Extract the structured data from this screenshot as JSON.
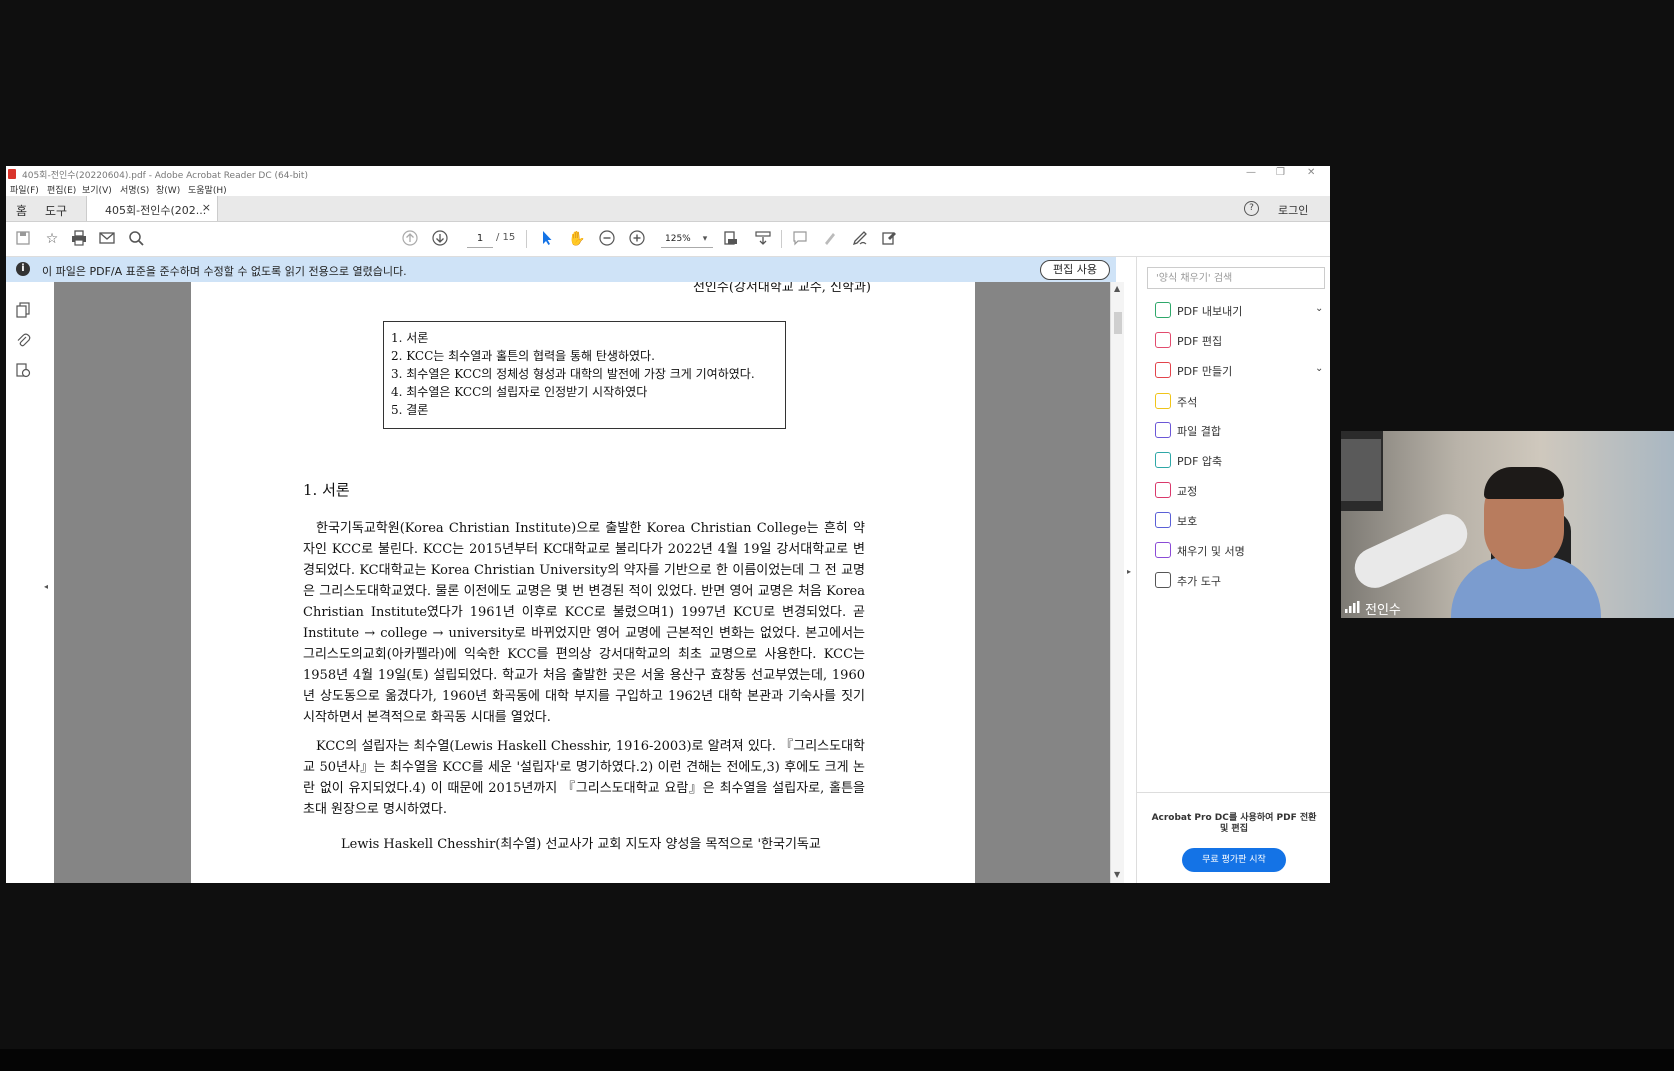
{
  "window": {
    "title": "405회-전인수(20220604).pdf - Adobe Acrobat Reader DC (64-bit)",
    "controls": {
      "minimize": "—",
      "restore": "❐",
      "close": "✕"
    }
  },
  "menu": [
    "파일(F)",
    "편집(E)",
    "보기(V)",
    "서명(S)",
    "창(W)",
    "도움말(H)"
  ],
  "tabs": {
    "home": "홈",
    "tools": "도구",
    "document": "405회-전인수(202...",
    "close": "×"
  },
  "header_right": {
    "help": "?",
    "login": "로그인"
  },
  "toolbar": {
    "page_current": "1",
    "page_total": "/ 15",
    "zoom": "125%"
  },
  "notice": {
    "icon": "i",
    "message": "이 파일은 PDF/A 표준을 준수하며 수정할 수 없도록 읽기 전용으로 열렸습니다.",
    "edit_button": "편집 사용"
  },
  "right_panel": {
    "search_placeholder": "'양식 채우기' 검색",
    "items": [
      {
        "label": "PDF 내보내기",
        "icon": "export-pdf-icon",
        "color": "#2ea76a",
        "chevron": true
      },
      {
        "label": "PDF 편집",
        "icon": "edit-pdf-icon",
        "color": "#e24b6d",
        "chevron": false
      },
      {
        "label": "PDF 만들기",
        "icon": "create-pdf-icon",
        "color": "#e2434b",
        "chevron": true
      },
      {
        "label": "주석",
        "icon": "comment-icon",
        "color": "#f0c419",
        "chevron": false
      },
      {
        "label": "파일 결합",
        "icon": "combine-files-icon",
        "color": "#6b57d6",
        "chevron": false
      },
      {
        "label": "PDF 압축",
        "icon": "compress-pdf-icon",
        "color": "#2ea7a7",
        "chevron": false
      },
      {
        "label": "교정",
        "icon": "redact-icon",
        "color": "#d9386b",
        "chevron": false
      },
      {
        "label": "보호",
        "icon": "protect-icon",
        "color": "#5a5fd6",
        "chevron": false
      },
      {
        "label": "채우기 및 서명",
        "icon": "fill-sign-icon",
        "color": "#8a4bd6",
        "chevron": false
      },
      {
        "label": "추가 도구",
        "icon": "more-tools-icon",
        "color": "#555555",
        "chevron": false
      }
    ],
    "promo_text": "Acrobat Pro DC를 사용하여 PDF 전환 및 편집",
    "promo_button": "무료 평가판 시작"
  },
  "document": {
    "author": "전인수(강서대학교 교수, 신학과)",
    "toc": [
      "1. 서론",
      "2. KCC는 최수열과 홀튼의 협력을 통해 탄생하였다.",
      "3. 최수열은 KCC의 정체성 형성과 대학의 발전에 가장 크게 기여하였다.",
      "4. 최수열은 KCC의 설립자로 인정받기 시작하였다",
      "5. 결론"
    ],
    "section_heading": "1. 서론",
    "paragraph1": "한국기독교학원(Korea Christian Institute)으로 출발한 Korea Christian College는 흔히 약자인 KCC로 불린다. KCC는 2015년부터 KC대학교로 불리다가 2022년 4월 19일 강서대학교로 변경되었다. KC대학교는 Korea Christian University의 약자를 기반으로 한 이름이었는데 그 전 교명은 그리스도대학교였다. 물론 이전에도 교명은 몇 번 변경된 적이 있었다. 반면 영어 교명은 처음 Korea Christian Institute였다가 1961년 이후로 KCC로 불렸으며1) 1997년 KCU로 변경되었다. 곧 Institute → college → university로 바뀌었지만 영어 교명에 근본적인 변화는 없었다. 본고에서는 그리스도의교회(아카펠라)에 익숙한 KCC를 편의상 강서대학교의 최초 교명으로 사용한다. KCC는 1958년 4월 19일(토) 설립되었다. 학교가 처음 출발한 곳은 서울 용산구 효창동 선교부였는데, 1960년 상도동으로 옮겼다가, 1960년 화곡동에 대학 부지를 구입하고 1962년 대학 본관과 기숙사를 짓기 시작하면서 본격적으로 화곡동 시대를 열었다.",
    "paragraph2": "KCC의 설립자는 최수열(Lewis Haskell Chesshir, 1916-2003)로 알려져 있다. 『그리스도대학교 50년사』는 최수열을 KCC를 세운 '설립자'로 명기하였다.2) 이런 견해는 전에도,3) 후에도 크게 논란 없이 유지되었다.4) 이 때문에 2015년까지 『그리스도대학교 요람』은 최수열을 설립자로, 홀튼을 초대 원장으로 명시하였다.",
    "paragraph3": "Lewis Haskell Chesshir(최수열) 선교사가 교회 지도자 양성을 목적으로 '한국기독교"
  },
  "webcam": {
    "participant_name": "전인수"
  }
}
